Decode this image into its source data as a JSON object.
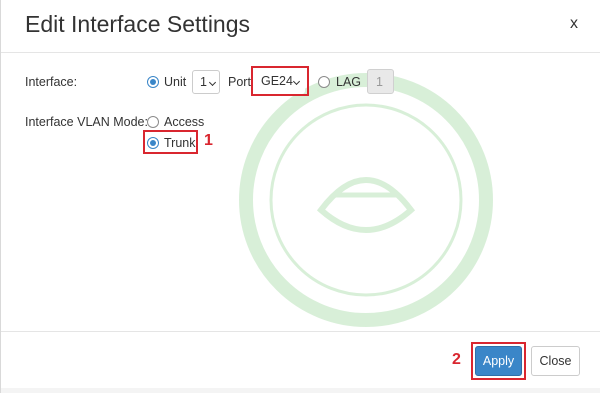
{
  "dialog": {
    "title": "Edit Interface Settings",
    "close_label": "x"
  },
  "interface": {
    "label": "Interface:",
    "unit_label": "Unit",
    "unit_selected": true,
    "unit_value": "1",
    "port_label": "Port",
    "port_value": "GE24",
    "lag_label": "LAG",
    "lag_selected": false,
    "lag_value": "1"
  },
  "vlan_mode": {
    "label": "Interface VLAN Mode:",
    "options": [
      {
        "label": "Access",
        "selected": false
      },
      {
        "label": "Trunk",
        "selected": true
      }
    ]
  },
  "annotations": {
    "step1": "1",
    "step2": "2"
  },
  "footer": {
    "apply_label": "Apply",
    "close_label": "Close"
  },
  "colors": {
    "accent": "#3a86c8",
    "highlight": "#d9262f",
    "watermark": "#2ea82e"
  }
}
